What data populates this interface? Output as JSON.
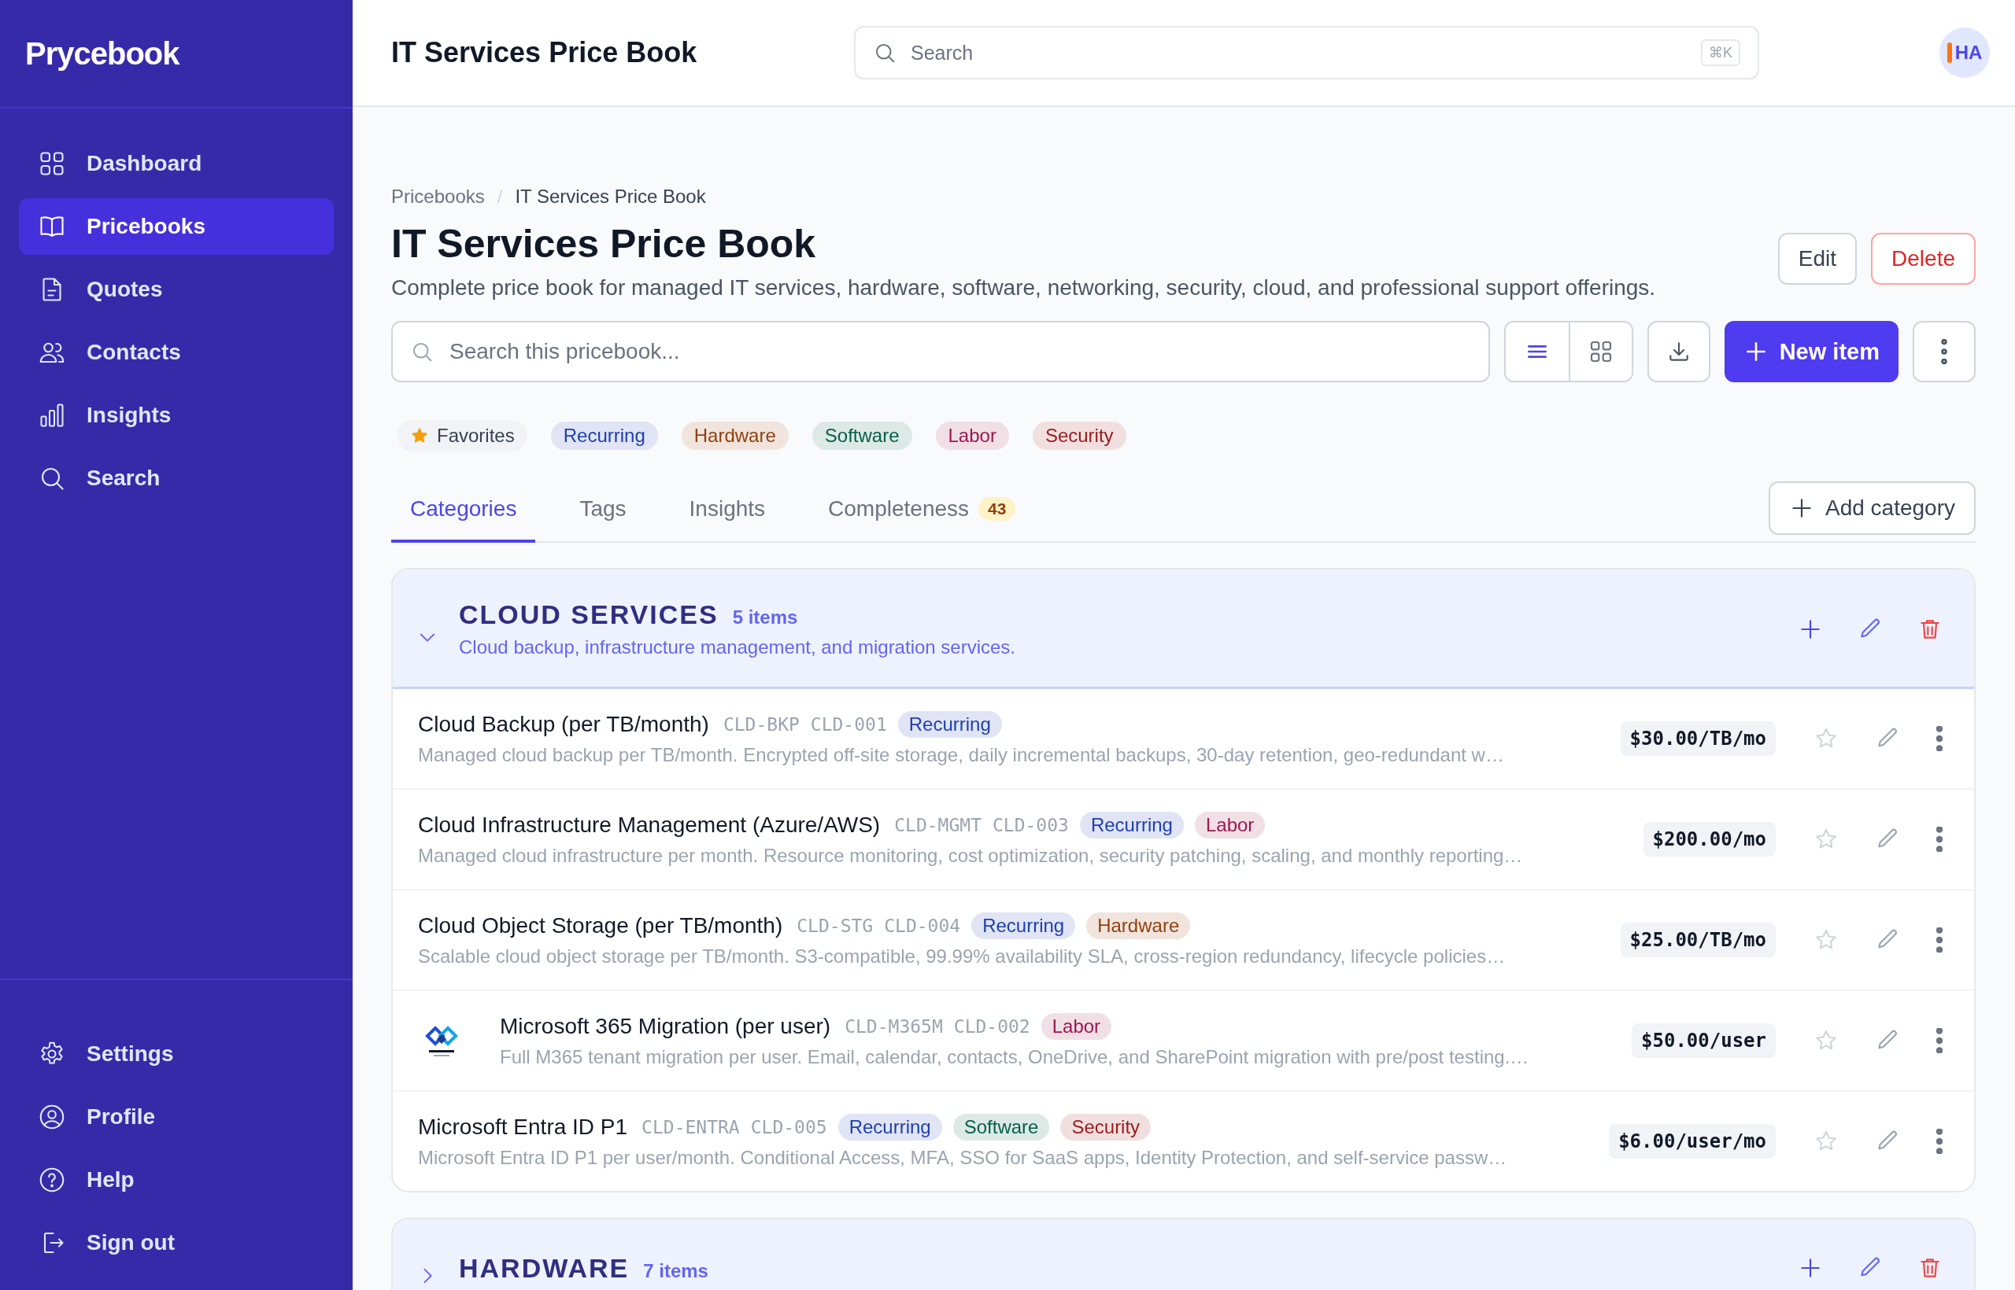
{
  "sidebar": {
    "logo": "Prycebook",
    "nav": [
      {
        "label": "Dashboard",
        "selected": false
      },
      {
        "label": "Pricebooks",
        "selected": true
      },
      {
        "label": "Quotes",
        "selected": false
      },
      {
        "label": "Contacts",
        "selected": false
      },
      {
        "label": "Insights",
        "selected": false
      },
      {
        "label": "Search",
        "selected": false
      }
    ],
    "footer_nav": [
      {
        "label": "Settings",
        "selected": false
      },
      {
        "label": "Profile",
        "selected": false
      },
      {
        "label": "Help",
        "selected": false
      },
      {
        "label": "Sign out",
        "selected": false
      }
    ]
  },
  "topbar": {
    "title": "IT Services Price Book",
    "search": {
      "placeholder": "Search",
      "shortcut": "⌘K"
    },
    "avatar": {
      "initials": "HA"
    }
  },
  "breadcrumb": {
    "separator": "/",
    "items": [
      {
        "label": "Pricebooks",
        "current": false
      },
      {
        "label": "IT Services Price Book",
        "current": true
      }
    ]
  },
  "page": {
    "title": "IT Services Price Book",
    "description": "Complete price book for managed IT services, hardware, software, networking, security, cloud, and professional support offerings.",
    "actions": [
      {
        "label": "Edit",
        "kind": "secondary"
      },
      {
        "label": "Delete",
        "kind": "danger"
      }
    ]
  },
  "toolbar": {
    "search": {
      "placeholder": "Search this pricebook..."
    },
    "views": [
      {
        "selected": true
      },
      {
        "selected": false
      }
    ],
    "new_item": "New item"
  },
  "filters": [
    {
      "label": "Favorites",
      "kind": "favorites"
    },
    {
      "label": "Recurring",
      "kind": "tag",
      "color": "#1e40af"
    },
    {
      "label": "Hardware",
      "kind": "tag",
      "color": "#92400e"
    },
    {
      "label": "Software",
      "kind": "tag",
      "color": "#065f46"
    },
    {
      "label": "Labor",
      "kind": "tag",
      "color": "#9d174d"
    },
    {
      "label": "Security",
      "kind": "tag",
      "color": "#991b1b"
    }
  ],
  "tabs": [
    {
      "label": "Categories",
      "selected": true
    },
    {
      "label": "Tags",
      "selected": false
    },
    {
      "label": "Insights",
      "selected": false
    },
    {
      "label": "Completeness",
      "selected": false,
      "badge": "43"
    }
  ],
  "add_category": "Add category",
  "categories": [
    {
      "name": "CLOUD SERVICES",
      "count": "5 items",
      "description": "Cloud backup, infrastructure management, and migration services.",
      "expanded": true,
      "items": [
        {
          "name": "Cloud Backup (per TB/month)",
          "codes": [
            "CLD-BKP",
            "CLD-001"
          ],
          "tags": [
            {
              "label": "Recurring",
              "color": "#1e40af"
            }
          ],
          "description": "Managed cloud backup per TB/month. Encrypted off-site storage, daily incremental backups, 30-day retention, geo-redundant w…",
          "price": "$30.00/TB/mo",
          "favorite": false
        },
        {
          "name": "Cloud Infrastructure Management (Azure/AWS)",
          "codes": [
            "CLD-MGMT",
            "CLD-003"
          ],
          "tags": [
            {
              "label": "Recurring",
              "color": "#1e40af"
            },
            {
              "label": "Labor",
              "color": "#9d174d"
            }
          ],
          "description": "Managed cloud infrastructure per month. Resource monitoring, cost optimization, security patching, scaling, and monthly reporting…",
          "price": "$200.00/mo",
          "favorite": false
        },
        {
          "name": "Cloud Object Storage (per TB/month)",
          "codes": [
            "CLD-STG",
            "CLD-004"
          ],
          "tags": [
            {
              "label": "Recurring",
              "color": "#1e40af"
            },
            {
              "label": "Hardware",
              "color": "#92400e"
            }
          ],
          "description": "Scalable cloud object storage per TB/month. S3-compatible, 99.99% availability SLA, cross-region redundancy, lifecycle policies…",
          "price": "$25.00/TB/mo",
          "favorite": false
        },
        {
          "name": "Microsoft 365 Migration (per user)",
          "codes": [
            "CLD-M365M",
            "CLD-002"
          ],
          "tags": [
            {
              "label": "Labor",
              "color": "#9d174d"
            }
          ],
          "description": "Full M365 tenant migration per user. Email, calendar, contacts, OneDrive, and SharePoint migration with pre/post testing.…",
          "price": "$50.00/user",
          "favorite": false,
          "image": {
            "kind": "picture"
          }
        },
        {
          "name": "Microsoft Entra ID P1",
          "codes": [
            "CLD-ENTRA",
            "CLD-005"
          ],
          "tags": [
            {
              "label": "Recurring",
              "color": "#1e40af"
            },
            {
              "label": "Software",
              "color": "#065f46"
            },
            {
              "label": "Security",
              "color": "#991b1b"
            }
          ],
          "description": "Microsoft Entra ID P1 per user/month. Conditional Access, MFA, SSO for SaaS apps, Identity Protection, and self-service passw…",
          "price": "$6.00/user/mo",
          "favorite": false
        }
      ]
    },
    {
      "name": "HARDWARE",
      "count": "7 items",
      "expanded": false
    }
  ]
}
